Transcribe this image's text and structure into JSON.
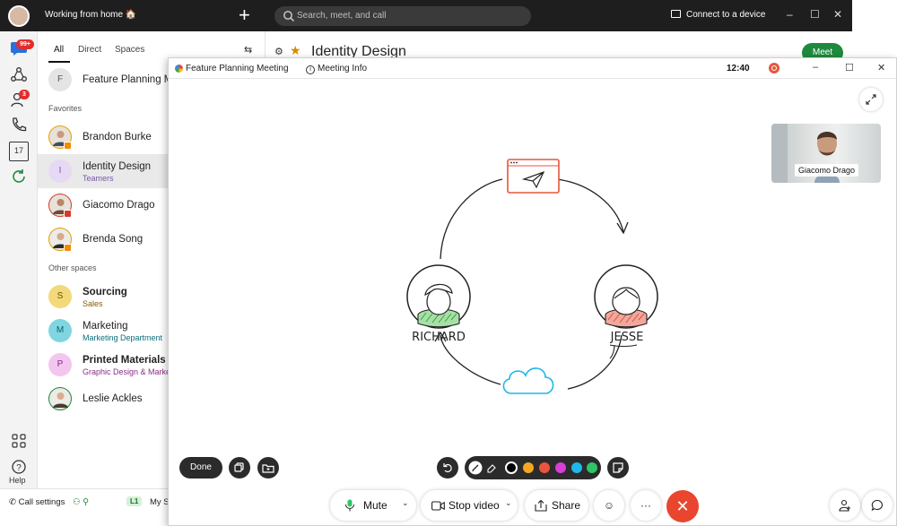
{
  "topbar": {
    "status": "Working from home 🏠",
    "search_placeholder": "Search, meet, and call",
    "connect_label": "Connect to a device",
    "minimize": "–",
    "maximize": "☐",
    "close": "✕"
  },
  "rail": {
    "messages_badge": "99+",
    "contacts_badge": "3",
    "calendar_day": "17",
    "help_label": "Help"
  },
  "spaces": {
    "tabs": [
      "All",
      "Direct",
      "Spaces"
    ],
    "pinned": {
      "initial": "F",
      "name": "Feature Planning Meeting"
    },
    "favorites_label": "Favorites",
    "favorites": [
      {
        "name": "Brandon Burke",
        "sub": "",
        "initial": ""
      },
      {
        "name": "Identity Design",
        "sub": "Teamers",
        "initial": "I"
      },
      {
        "name": "Giacomo Drago",
        "sub": "",
        "initial": ""
      },
      {
        "name": "Brenda Song",
        "sub": "",
        "initial": ""
      }
    ],
    "other_label": "Other spaces",
    "other": [
      {
        "name": "Sourcing",
        "sub": "Sales",
        "initial": "S"
      },
      {
        "name": "Marketing",
        "sub": "Marketing Department",
        "initial": "M"
      },
      {
        "name": "Printed Materials",
        "sub": "Graphic Design & Marketing",
        "initial": "P"
      },
      {
        "name": "Leslie Ackles",
        "sub": "",
        "initial": ""
      }
    ]
  },
  "bottombar": {
    "call_settings": "Call settings",
    "line": "L1",
    "my_space": "My S"
  },
  "space_header": {
    "title": "Identity Design",
    "meet_label": "Meet"
  },
  "meeting": {
    "title": "Feature Planning Meeting",
    "info_label": "Meeting Info",
    "time": "12:40",
    "self_view_name": "Giacomo Drago",
    "whiteboard": {
      "left_name": "RICHARD",
      "right_name": "JESSE"
    },
    "done_label": "Done",
    "palette_colors": [
      "#000000",
      "#f5a623",
      "#e8553e",
      "#d63fd6",
      "#1fb6e8",
      "#2ec46a"
    ],
    "controls": {
      "mute": "Mute",
      "stop_video": "Stop video",
      "share": "Share",
      "more": "···"
    }
  }
}
